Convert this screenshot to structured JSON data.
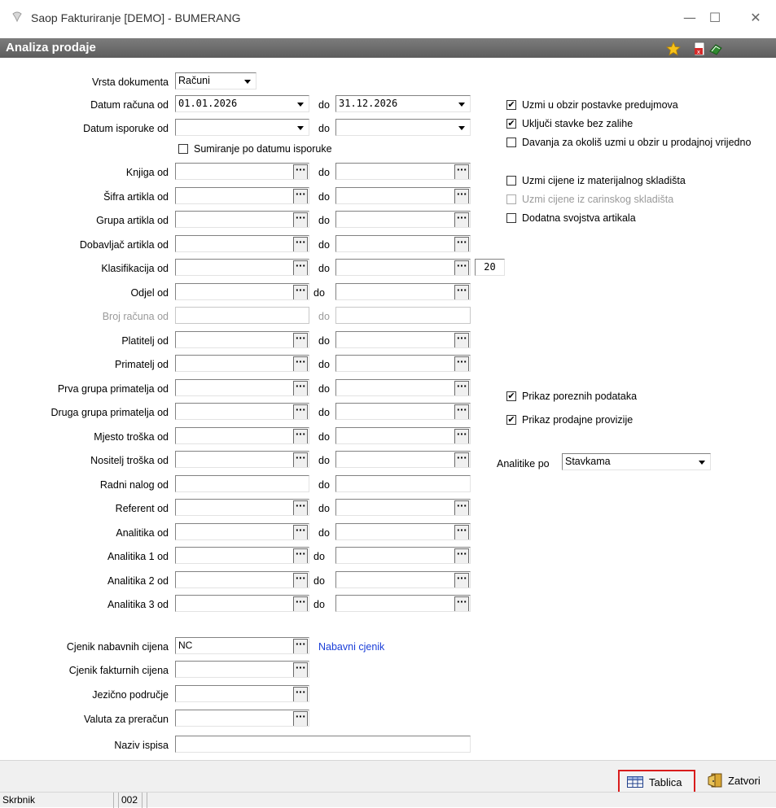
{
  "window": {
    "title": "Saop Fakturiranje [DEMO] - BUMERANG"
  },
  "header": {
    "caption": "Analiza prodaje"
  },
  "form": {
    "vrsta_dokumenta": {
      "label": "Vrsta dokumenta",
      "value": "Računi"
    },
    "datum_racuna": {
      "label": "Datum računa od",
      "from": "01.01.2026",
      "to_label": "do",
      "to": "31.12.2026"
    },
    "datum_isporuke": {
      "label": "Datum isporuke od",
      "from": "",
      "to_label": "do",
      "to": ""
    },
    "sumiranje": {
      "label": "Sumiranje po datumu isporuke",
      "checked": false
    },
    "ranges": [
      {
        "label": "Knjiga od",
        "to_label": "do"
      },
      {
        "label": "Šifra artikla od",
        "to_label": "do"
      },
      {
        "label": "Grupa artikla od",
        "to_label": "do"
      },
      {
        "label": "Dobavljač artikla od",
        "to_label": "do"
      },
      {
        "label": "Klasifikacija od",
        "to_label": "do",
        "extra": "20"
      },
      {
        "label": "Odjel od",
        "to_label": "do"
      },
      {
        "label": "Broj računa od",
        "to_label": "do"
      },
      {
        "label": "Platitelj od",
        "to_label": "do"
      },
      {
        "label": "Primatelj od",
        "to_label": "do"
      },
      {
        "label": "Prva grupa primatelja od",
        "to_label": "do"
      },
      {
        "label": "Druga grupa primatelja od",
        "to_label": "do"
      },
      {
        "label": "Mjesto troška od",
        "to_label": "do"
      },
      {
        "label": "Nositelj troška od",
        "to_label": "do"
      },
      {
        "label": "Radni nalog od",
        "to_label": "do"
      },
      {
        "label": "Referent od",
        "to_label": "do"
      },
      {
        "label": "Analitika od",
        "to_label": "do"
      },
      {
        "label": "Analitika 1 od",
        "to_label": "do"
      },
      {
        "label": "Analitika 2 od",
        "to_label": "do"
      },
      {
        "label": "Analitika 3 od",
        "to_label": "do"
      }
    ],
    "cjenik_nabavnih": {
      "label": "Cjenik nabavnih cijena",
      "value": "NC",
      "description": "Nabavni cjenik"
    },
    "cjenik_fakturnih": {
      "label": "Cjenik fakturnih cijena",
      "value": ""
    },
    "jezicno_podrucje": {
      "label": "Jezično područje",
      "value": ""
    },
    "valuta": {
      "label": "Valuta za preračun",
      "value": ""
    },
    "naziv_ispisa": {
      "label": "Naziv ispisa",
      "value": ""
    }
  },
  "options": {
    "uzmi_predujmova": {
      "label": "Uzmi u obzir postavke predujmova",
      "checked": true
    },
    "ukljuci_bez_zalihe": {
      "label": "Uključi stavke bez zalihe",
      "checked": true
    },
    "davanja_okolis": {
      "label": "Davanja za okoliš uzmi u obzir u prodajnoj vrijedno",
      "checked": false
    },
    "cijene_materijalnog": {
      "label": "Uzmi cijene iz materijalnog skladišta",
      "checked": false
    },
    "cijene_carinskog": {
      "label": "Uzmi cijene iz carinskog skladišta",
      "checked": false
    },
    "dodatna_svojstva": {
      "label": "Dodatna svojstva artikala",
      "checked": false
    },
    "prikaz_poreznih": {
      "label": "Prikaz poreznih podataka",
      "checked": true
    },
    "prikaz_provizije": {
      "label": "Prikaz prodajne provizije",
      "checked": true
    },
    "analitike_po": {
      "label": "Analitike po",
      "value": "Stavkama"
    }
  },
  "footer": {
    "tablica_label": "Tablica",
    "zatvori_label": "Zatvori"
  },
  "status": {
    "user": "Skrbnik",
    "code": "002"
  },
  "colors": {
    "header_bg": "#6b6b6b",
    "highlight_border": "#d91c1c",
    "link": "#1a3ed8"
  }
}
